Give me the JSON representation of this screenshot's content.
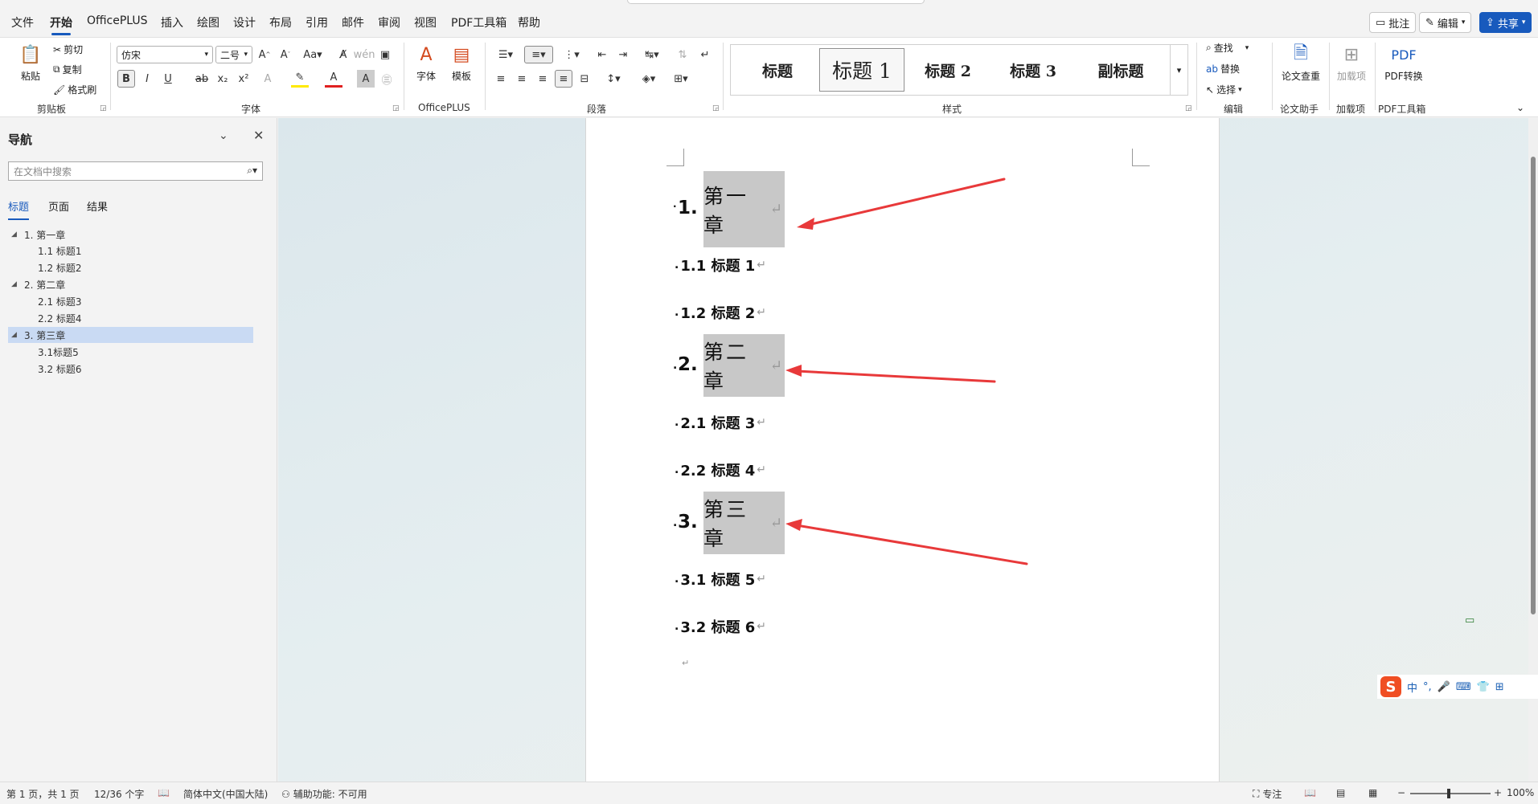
{
  "menu": {
    "tabs": [
      "文件",
      "开始",
      "OfficePLUS",
      "插入",
      "绘图",
      "设计",
      "布局",
      "引用",
      "邮件",
      "审阅",
      "视图",
      "PDF工具箱",
      "帮助"
    ],
    "active_tab": "开始",
    "comment_btn": "批注",
    "edit_btn": "编辑",
    "share_btn": "共享"
  },
  "ribbon": {
    "clipboard": {
      "paste": "粘贴",
      "cut": "剪切",
      "copy": "复制",
      "format_painter": "格式刷",
      "label": "剪贴板"
    },
    "font": {
      "font_name": "仿宋",
      "font_size": "二号",
      "bold": "B",
      "italic": "I",
      "underline": "U",
      "strike": "ab",
      "subscript": "x₂",
      "superscript": "x²",
      "label": "字体"
    },
    "officeplus": {
      "font": "字体",
      "template": "模板",
      "label": "OfficePLUS"
    },
    "paragraph": {
      "label": "段落"
    },
    "styles": {
      "items": [
        "标题",
        "标题 1",
        "标题 2",
        "标题 3",
        "副标题"
      ],
      "selected": "标题 1",
      "label": "样式"
    },
    "editing": {
      "find": "查找",
      "replace": "替换",
      "select": "选择",
      "label": "编辑"
    },
    "paper": {
      "check": "论文查重",
      "label": "论文助手"
    },
    "addins": {
      "btn": "加载项",
      "label": "加载项"
    },
    "pdf": {
      "convert": "PDF转换",
      "label": "PDF工具箱"
    }
  },
  "nav": {
    "title": "导航",
    "search_placeholder": "在文档中搜索",
    "tabs": [
      "标题",
      "页面",
      "结果"
    ],
    "active_tab": "标题",
    "tree": [
      {
        "label": "1. 第一章",
        "level": 1,
        "selected": false
      },
      {
        "label": "1.1 标题1",
        "level": 2,
        "selected": false
      },
      {
        "label": "1.2 标题2",
        "level": 2,
        "selected": false
      },
      {
        "label": "2. 第二章",
        "level": 1,
        "selected": false
      },
      {
        "label": "2.1 标题3",
        "level": 2,
        "selected": false
      },
      {
        "label": "2.2 标题4",
        "level": 2,
        "selected": false
      },
      {
        "label": "3. 第三章",
        "level": 1,
        "selected": true
      },
      {
        "label": "3.1标题5",
        "level": 2,
        "selected": false
      },
      {
        "label": "3.2 标题6",
        "level": 2,
        "selected": false
      }
    ]
  },
  "document": {
    "chapters": [
      {
        "num": "1.",
        "title": "第一章"
      },
      {
        "num": "2.",
        "title": "第二章"
      },
      {
        "num": "3.",
        "title": "第三章"
      }
    ],
    "subheads": [
      "1.1  标题 1",
      "1.2  标题 2",
      "2.1 标题 3",
      "2.2 标题 4",
      "3.1 标题 5",
      "3.2  标题 6"
    ],
    "para_mark": "↵",
    "arrow_color": "#e8393a"
  },
  "ime": {
    "lang": "中"
  },
  "status": {
    "page": "第 1 页，共 1 页",
    "words": "12/36 个字",
    "language": "简体中文(中国大陆)",
    "accessibility": "辅助功能: 不可用",
    "focus": "专注",
    "zoom": "100%"
  },
  "colors": {
    "accent": "#185abd",
    "selection": "#c9daf3",
    "shade": "#c8c8c8"
  }
}
